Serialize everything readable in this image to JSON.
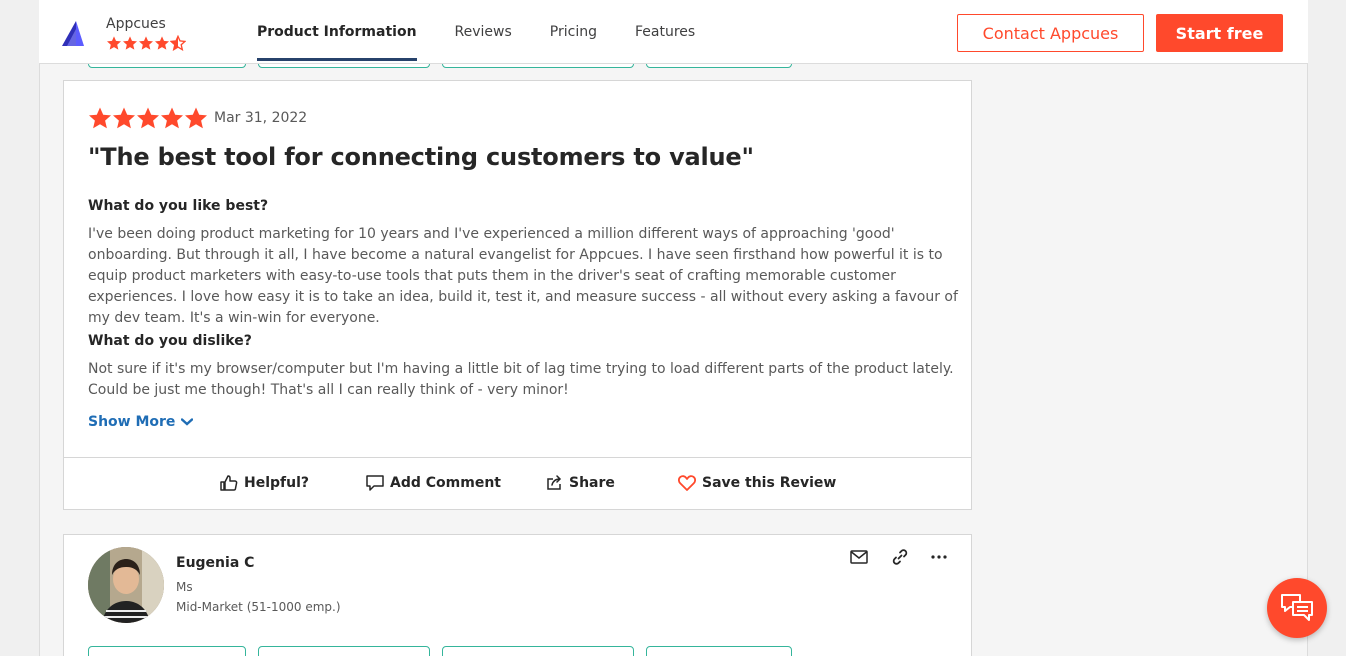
{
  "header": {
    "brand_name": "Appcues",
    "brand_rating": 4.5,
    "tabs": [
      {
        "label": "Product Information",
        "active": true
      },
      {
        "label": "Reviews",
        "active": false
      },
      {
        "label": "Pricing",
        "active": false
      },
      {
        "label": "Features",
        "active": false
      }
    ],
    "contact_label": "Contact Appcues",
    "start_label": "Start free"
  },
  "colors": {
    "accent": "#ff492c",
    "link": "#1f6db5",
    "tab_underline": "#27426b",
    "pill_border": "#35b59b"
  },
  "review": {
    "stars": 5,
    "date": "Mar 31, 2022",
    "title": "\"The best tool for connecting customers to value\"",
    "like_question": "What do you like best?",
    "like_answer": "I've been doing product marketing for 10 years and I've experienced a million different ways of approaching 'good' onboarding. But through it all, I have become a natural evangelist for Appcues. I have seen firsthand how powerful it is to equip product marketers with easy-to-use tools that puts them in the driver's seat of crafting memorable customer experiences. I love how easy it is to take an idea, build it, test it, and measure success - all without every asking a favour of my dev team. It's a win-win for everyone.",
    "dislike_question": "What do you dislike?",
    "dislike_answer": "Not sure if it's my browser/computer but I'm having a little bit of lag time trying to load different parts of the product lately. Could be just me though! That's all I can really think of - very minor!",
    "show_more": "Show More",
    "actions": {
      "helpful": "Helpful?",
      "comment": "Add Comment",
      "share": "Share",
      "save": "Save this Review"
    }
  },
  "reviewer": {
    "name": "Eugenia C",
    "role": "Ms",
    "segment": "Mid-Market (51-1000 emp.)"
  },
  "icons": {
    "logo": "appcues-logo",
    "star": "star-icon",
    "half_star": "half-star-icon",
    "chevron": "chevron-down-icon",
    "thumb": "thumbs-up-icon",
    "comment": "comment-icon",
    "share": "share-icon",
    "heart": "heart-icon",
    "mail": "mail-icon",
    "link": "link-icon",
    "more": "more-icon",
    "chat": "chat-icon"
  }
}
